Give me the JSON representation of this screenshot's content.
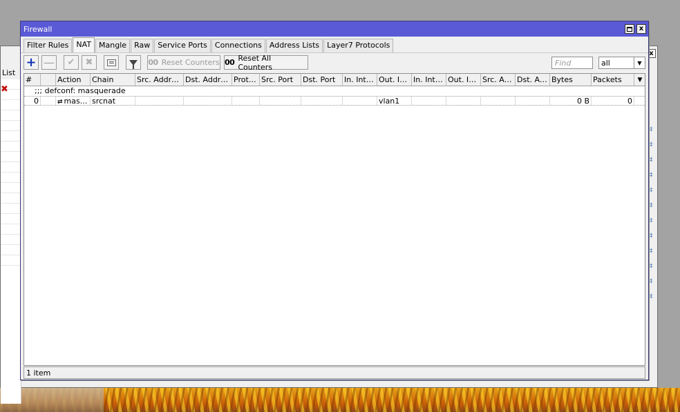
{
  "background_window": {
    "list_label": "List",
    "close_label": "x"
  },
  "window": {
    "title": "Firewall",
    "controls": {
      "restore": "",
      "close": "x"
    }
  },
  "tabs": [
    {
      "label": "Filter Rules",
      "active": false
    },
    {
      "label": "NAT",
      "active": true
    },
    {
      "label": "Mangle",
      "active": false
    },
    {
      "label": "Raw",
      "active": false
    },
    {
      "label": "Service Ports",
      "active": false
    },
    {
      "label": "Connections",
      "active": false
    },
    {
      "label": "Address Lists",
      "active": false
    },
    {
      "label": "Layer7 Protocols",
      "active": false
    }
  ],
  "toolbar": {
    "reset_counters_label": "Reset Counters",
    "reset_all_counters_label": "Reset All Counters",
    "oo_glyph": "00",
    "find_placeholder": "Find",
    "filter_select_value": "all"
  },
  "table": {
    "columns": [
      "#",
      "",
      "Action",
      "Chain",
      "Src. Address",
      "Dst. Address",
      "Proto...",
      "Src. Port",
      "Dst. Port",
      "In. Inter...",
      "Out. Int...",
      "In. Inter...",
      "Out. Int...",
      "Src. Ad...",
      "Dst. Ad...",
      "Bytes",
      "Packets"
    ],
    "comment": ";;; defconf: masquerade",
    "rows": [
      {
        "index": "0",
        "flag": "",
        "action": "mas...",
        "chain": "srcnat",
        "src_address": "",
        "dst_address": "",
        "protocol": "",
        "src_port": "",
        "dst_port": "",
        "in_interface": "",
        "out_interface": "vlan1",
        "in_interface_list": "",
        "out_interface_list": "",
        "src_address_list": "",
        "dst_address_list": "",
        "bytes": "0 B",
        "packets": "0"
      }
    ]
  },
  "status": {
    "item_count": "1 item"
  },
  "colors": {
    "titlebar": "#5a5ad6",
    "add_icon": "#1533b8",
    "selected_row": "#b5cde8"
  }
}
